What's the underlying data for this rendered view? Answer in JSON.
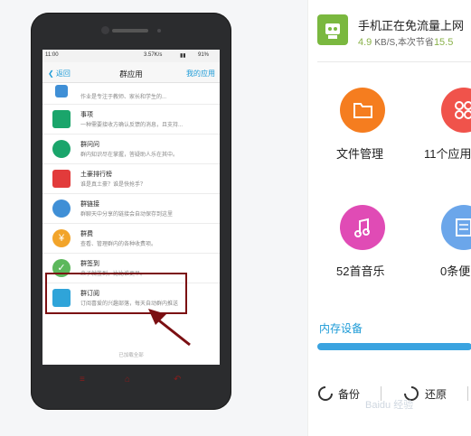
{
  "phone": {
    "status": {
      "time": "11:00",
      "speed": "3.57K/s",
      "battery": "91%"
    },
    "nav": {
      "back": "返回",
      "title": "群应用",
      "mine": "我的应用"
    },
    "items": [
      {
        "title": "",
        "desc": "作业是专注于教师、家长和学生的...",
        "color": "#3f8fd6"
      },
      {
        "title": "事项",
        "desc": "一种需要接收方确认反馈的消息，且支持...",
        "color": "#1aa56b"
      },
      {
        "title": "群问问",
        "desc": "群内知识尽在掌握，答疑助人乐在其中。",
        "color": "#1aa56b"
      },
      {
        "title": "土豪排行榜",
        "desc": "谁是真土豪？谁是快抢手？",
        "color": "#e23b3b"
      },
      {
        "title": "群链接",
        "desc": "群聊天中分享的链接会自动保存到这里",
        "color": "#3f8fd6"
      },
      {
        "title": "群费",
        "desc": "查看、管理群内的各种收费项。",
        "color": "#f2a42a"
      },
      {
        "title": "群签到",
        "desc": "来了就签到，比比谁更早。",
        "color": "#5cb85c"
      },
      {
        "title": "群订阅",
        "desc": "订阅喜爱的兴趣部落，每天自动群内推送",
        "color": "#2fa4d9"
      }
    ],
    "loaded": "已加载全部"
  },
  "panel": {
    "net_title": "手机正在免流量上网",
    "speed_value": "4.9",
    "speed_unit": "KB/S,",
    "saved_label": "本次节省",
    "saved_value": "15.5",
    "tiles": [
      {
        "label": "文件管理",
        "color": "#f57d1f",
        "icon": "folder-icon"
      },
      {
        "label": "11个应用",
        "color": "#f0534b",
        "icon": "apps-grid-icon"
      },
      {
        "label": "52首音乐",
        "color": "#e04bb5",
        "icon": "music-icon"
      },
      {
        "label": "0条便",
        "color": "#6ba6ea",
        "icon": "note-icon"
      }
    ],
    "storage_title": "内存设备",
    "backup": "备份",
    "restore": "还原"
  },
  "watermark": "Baidu 经验"
}
